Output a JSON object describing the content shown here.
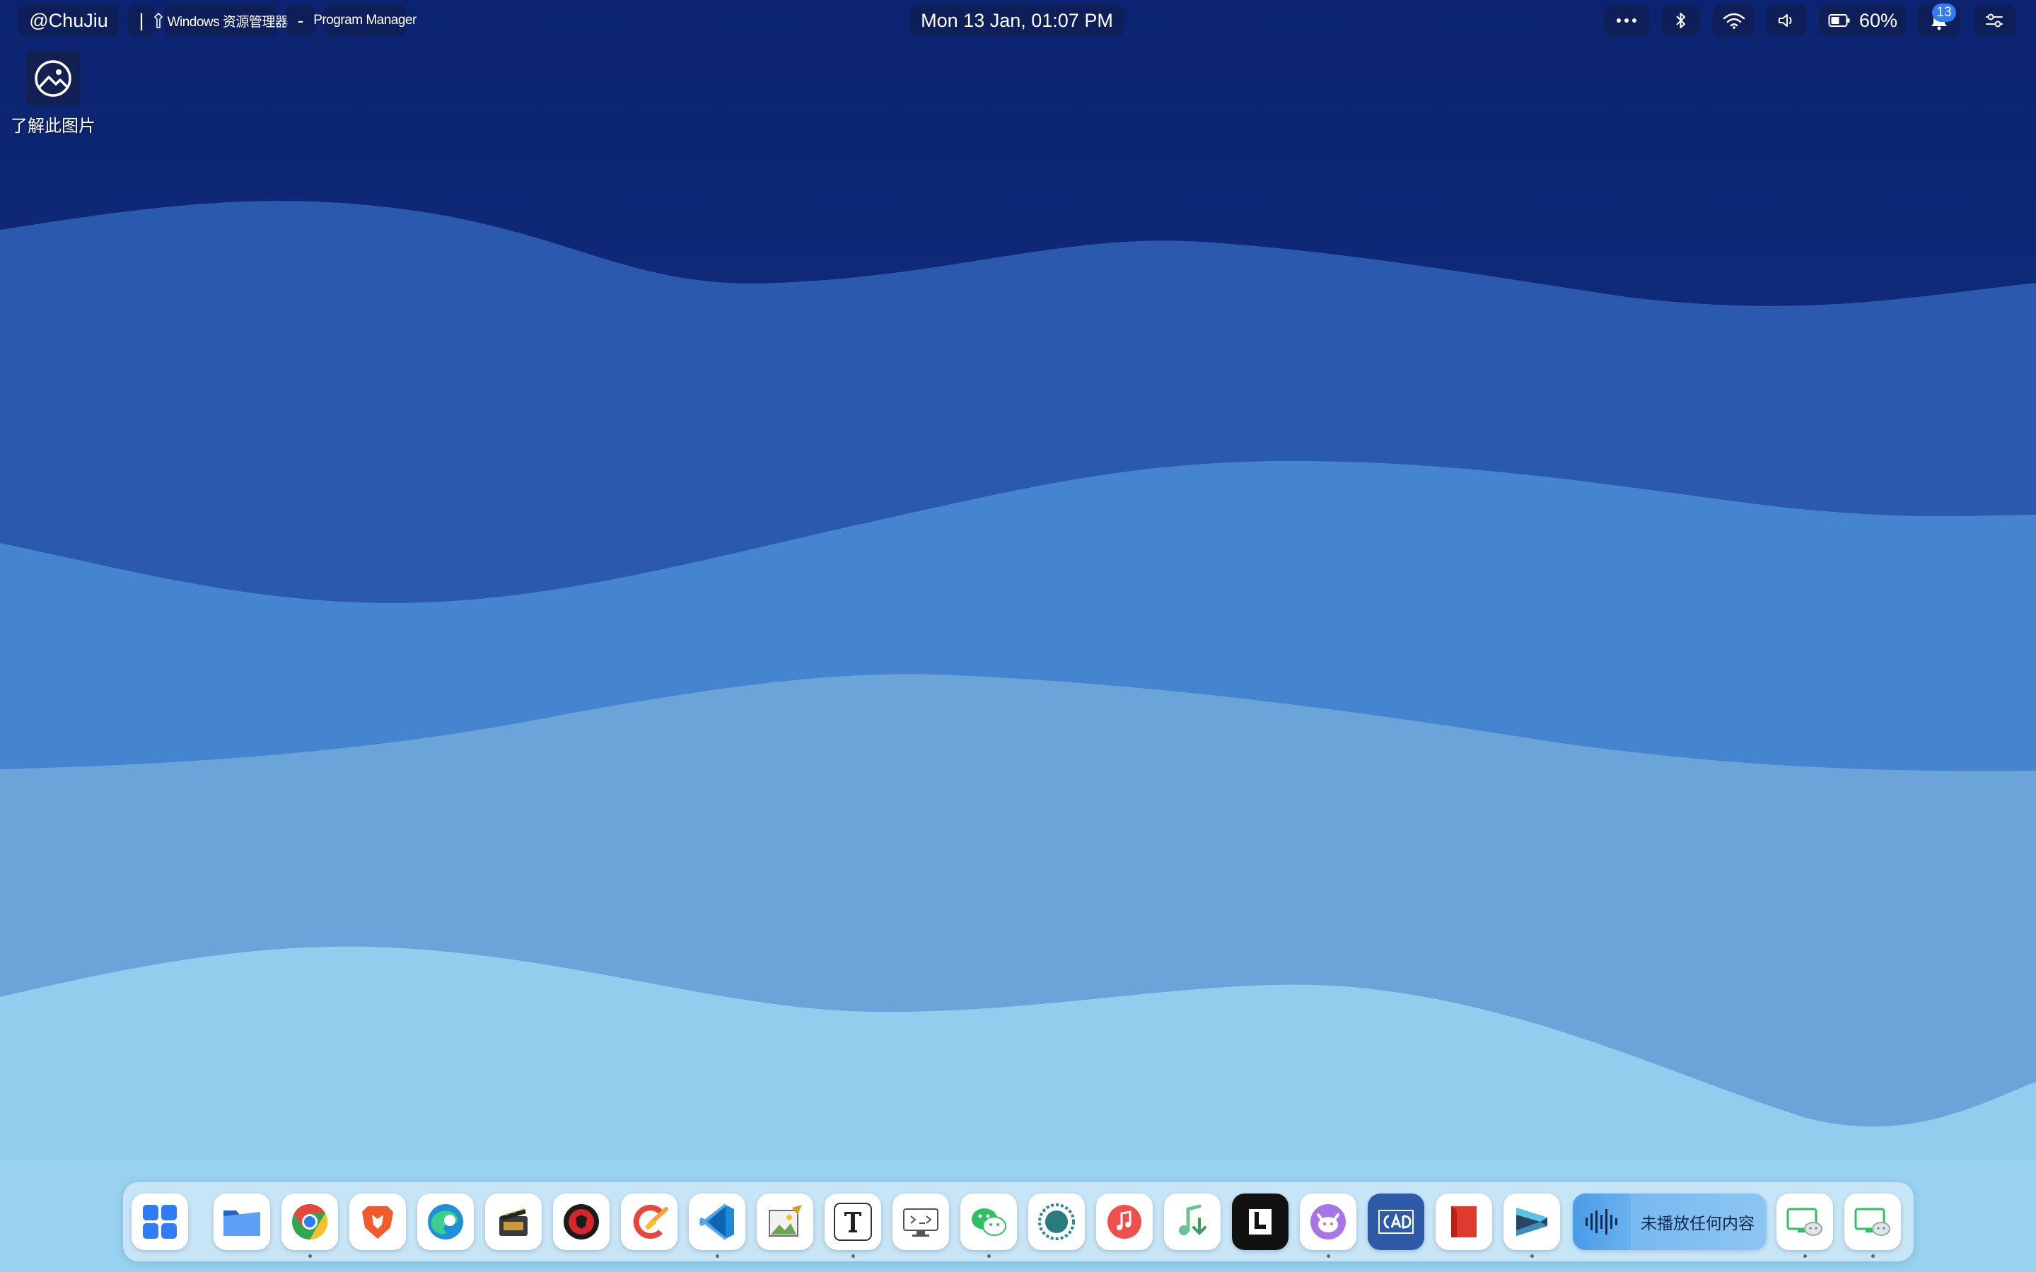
{
  "topbar": {
    "user": "@ChuJiu",
    "divider": "|",
    "window_app": "Windows 资源管理器",
    "window_separator": "-",
    "window_title": "Program Manager",
    "datetime": "Mon 13 Jan, 01:07 PM",
    "battery_percent": "60%",
    "notification_count": "13",
    "tray_icons": [
      "more-icon",
      "bluetooth-icon",
      "wifi-icon",
      "volume-icon",
      "battery-icon",
      "bell-icon",
      "control-center-icon"
    ]
  },
  "desktop": {
    "icons": [
      {
        "label": "了解此图片",
        "icon": "image-info-icon"
      }
    ]
  },
  "dock": {
    "items": [
      {
        "name": "start-menu-icon",
        "running": false
      },
      {
        "name": "file-explorer-icon",
        "running": false
      },
      {
        "name": "chrome-icon",
        "running": true
      },
      {
        "name": "brave-icon",
        "running": false
      },
      {
        "name": "edge-icon",
        "running": false
      },
      {
        "name": "media-app-icon",
        "running": false
      },
      {
        "name": "red-shield-icon",
        "running": false
      },
      {
        "name": "ccleaner-icon",
        "running": false
      },
      {
        "name": "vscode-icon",
        "running": true
      },
      {
        "name": "image-editor-icon",
        "running": false
      },
      {
        "name": "typora-icon",
        "running": true
      },
      {
        "name": "remote-desktop-icon",
        "running": false
      },
      {
        "name": "wechat-icon",
        "running": true
      },
      {
        "name": "teal-dot-icon",
        "running": false
      },
      {
        "name": "music-icon",
        "running": false
      },
      {
        "name": "music-download-icon",
        "running": false
      },
      {
        "name": "l-app-icon",
        "running": false
      },
      {
        "name": "cat-app-icon",
        "running": true
      },
      {
        "name": "cad-icon",
        "running": false
      },
      {
        "name": "red-book-icon",
        "running": false
      },
      {
        "name": "terminal-app-icon",
        "running": true
      }
    ],
    "media_widget": {
      "text": "未播放任何内容",
      "icon": "waveform-icon"
    },
    "trailing_items": [
      {
        "name": "wechat-screen-icon",
        "running": true
      },
      {
        "name": "wechat-screen-icon-2",
        "running": true
      }
    ]
  },
  "colors": {
    "wallpaper_top": "#0e2a78",
    "wallpaper_bottom": "#a6dcf4",
    "accent": "#2f7cf6",
    "topbar_pill": "#101c46"
  }
}
